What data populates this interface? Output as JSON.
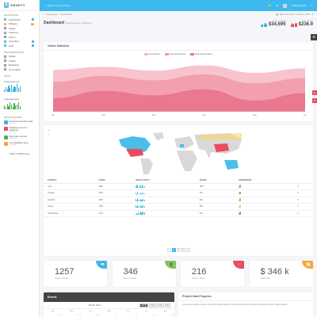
{
  "brand": {
    "name": "SMARTY"
  },
  "topbar": {
    "search_placeholder": "Search for something...",
    "user_name": "Felipe Antona"
  },
  "breadcrumb": {
    "items": [
      "Homepage",
      "Dashboard"
    ],
    "date_range": "March 13, 2017 - April 11, 2017"
  },
  "page": {
    "title": "Dashboard",
    "subtitle": "Good morning, Bradgen!"
  },
  "kpis": [
    {
      "label": "TODAY'S SALES",
      "value": "$34,695",
      "color": "#3fb1e0",
      "bars": [
        0.4,
        0.7,
        0.5,
        0.9,
        0.6,
        1,
        0.8
      ]
    },
    {
      "label": "LAST MONTH",
      "value": "$236.9",
      "color": "#e94c5f",
      "bars": [
        0.6,
        0.9,
        0.5,
        0.8,
        1,
        0.7,
        0.9
      ]
    }
  ],
  "sidebar": {
    "sections": [
      {
        "title": "NAVIGATION",
        "items": [
          {
            "label": "Dashboard",
            "badge": "",
            "color": "#3fb1e0"
          },
          {
            "label": "Widgets",
            "badge": "5",
            "color": "#f7a63a"
          },
          {
            "label": "Pages",
            "badge": "",
            "color": ""
          },
          {
            "label": "Features",
            "badge": "",
            "color": ""
          },
          {
            "label": "Forms",
            "badge": "",
            "color": ""
          },
          {
            "label": "Animation",
            "badge": "",
            "color": "#3fb1e0"
          },
          {
            "label": "Help",
            "badge": "",
            "color": "#3fb1e0"
          }
        ]
      },
      {
        "title": "DOCUMENTATION",
        "items": [
          {
            "label": "Tables",
            "badge": "",
            "color": ""
          },
          {
            "label": "Charts",
            "badge": "",
            "color": ""
          },
          {
            "label": "Bootstrap",
            "badge": "",
            "color": ""
          },
          {
            "label": "Icon Packs",
            "badge": "",
            "color": ""
          }
        ]
      }
    ],
    "stats_title": "STATS",
    "mini_charts": [
      {
        "title": "Today Earnings",
        "bars": [
          0.3,
          0.6,
          0.4,
          0.8,
          0.5,
          0.9,
          0.4,
          0.7,
          0.6,
          1,
          0.5,
          0.7
        ]
      },
      {
        "title": "Yesterday Earn",
        "bars": [
          0.5,
          0.3,
          0.7,
          0.4,
          0.9,
          0.6,
          0.3,
          0.8,
          0.5,
          0.6,
          0.9,
          0.4
        ]
      }
    ],
    "notifications_title": "NOTIFICATIONS",
    "notifications": [
      {
        "text": "Purchase & pending tasks",
        "sub": "Just now",
        "color": "#3fb1e0"
      },
      {
        "text": "Database error from webserver",
        "sub": "2 min ago",
        "color": "#e94c5f"
      },
      {
        "text": "New order received",
        "sub": "12 min ago",
        "color": "#4caf50"
      },
      {
        "text": "Long database query",
        "sub": "1 hour ago",
        "color": "#f7a63a"
      }
    ],
    "storage": "7000 of 28000 Free"
  },
  "visitor": {
    "title": "Visitor Statistics",
    "chart_data": {
      "type": "area",
      "categories": [
        "Jan",
        "Feb",
        "Mar",
        "Apr",
        "May",
        "Jun"
      ],
      "series": [
        {
          "name": "New Visitors",
          "color": "#f7b8c3",
          "values": [
            56,
            60,
            55,
            62,
            52,
            58
          ]
        },
        {
          "name": "Returned Visitors",
          "color": "#f19aaa",
          "values": [
            40,
            48,
            42,
            50,
            38,
            45
          ]
        },
        {
          "name": "Registered Visitors",
          "color": "#e9718a",
          "values": [
            18,
            28,
            22,
            30,
            15,
            25
          ]
        }
      ]
    }
  },
  "table": {
    "headers": [
      "COUNTRY",
      "USERS",
      "USER ACTIVITY",
      "ONLINE",
      "COMPARISON",
      ""
    ],
    "rows": [
      {
        "country": "USA",
        "users": "4388",
        "online": "1567"
      },
      {
        "country": "Canada",
        "users": "1526",
        "online": "765"
      },
      {
        "country": "Australia",
        "users": "1654",
        "online": "583"
      },
      {
        "country": "France",
        "users": "1789",
        "online": "684"
      },
      {
        "country": "Great Britain",
        "users": "1478",
        "online": "821"
      }
    ],
    "pages": [
      "‹",
      "1",
      "2",
      "3",
      "›"
    ]
  },
  "stats": [
    {
      "value": "1257",
      "caption": "Visitors / Month",
      "color": "#3eb9f0",
      "icon": "💬"
    },
    {
      "value": "346",
      "caption": "Orders / Month",
      "color": "#8bc34a",
      "icon": "👤"
    },
    {
      "value": "216",
      "caption": "Orders / Month",
      "color": "#e94c5f",
      "icon": "🛒"
    },
    {
      "value": "$ 346 k",
      "caption": "Total Profit",
      "color": "#f7a63a",
      "icon": "📈"
    }
  ],
  "events": {
    "title": "Events",
    "month": "March 2017",
    "views": [
      "month",
      "week",
      "day",
      "list"
    ],
    "days": [
      "Sun",
      "Mon",
      "Tue",
      "Wed",
      "Thu",
      "Fri",
      "Sat"
    ],
    "dates": [
      "26",
      "27",
      "28",
      "1",
      "2",
      "3",
      "4"
    ]
  },
  "progress": {
    "title": "Project Data Progress",
    "text": "Lorem ipsum dolor sit amet, consectetur adipiscing elit, sed eiusmod tempor incididunt ut labore et dolore magna aliqua."
  }
}
